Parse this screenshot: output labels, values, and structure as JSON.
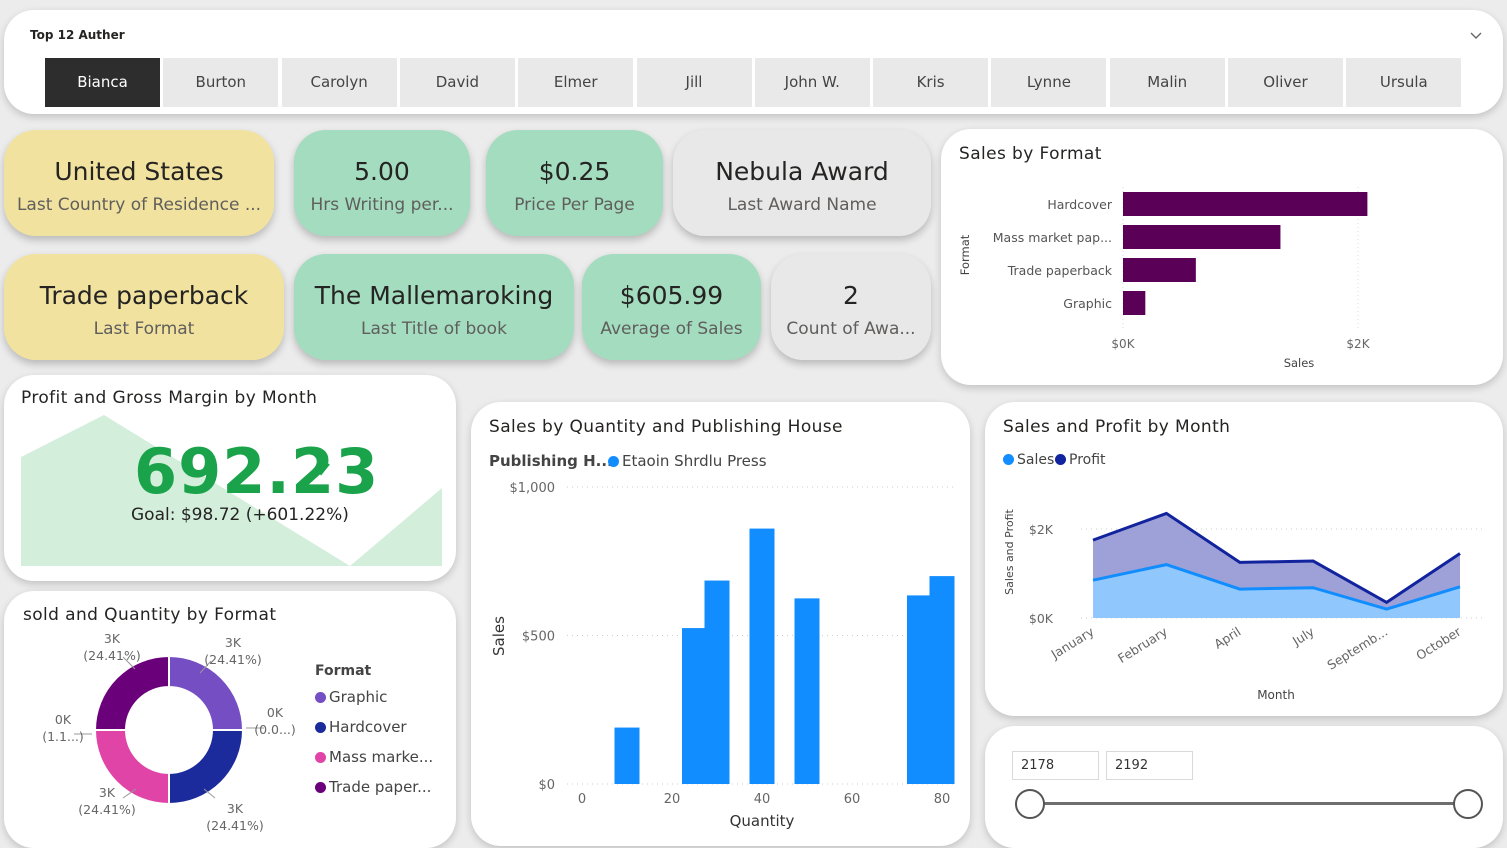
{
  "author_slicer": {
    "title": "Top 12 Auther",
    "chevron_icon": "chevron-down-icon",
    "authors": [
      "Bianca",
      "Burton",
      "Carolyn",
      "David",
      "Elmer",
      "Jill",
      "John W.",
      "Kris",
      "Lynne",
      "Malin",
      "Oliver",
      "Ursula"
    ],
    "selected": "Bianca"
  },
  "cards": [
    {
      "value": "United States",
      "label": "Last Country of Residence ...",
      "color": "#f1e39f"
    },
    {
      "value": "5.00",
      "label": "Hrs Writing per...",
      "color": "#a3dcbf"
    },
    {
      "value": "$0.25",
      "label": "Price Per Page",
      "color": "#a3dcbf"
    },
    {
      "value": "Nebula Award",
      "label": "Last Award Name",
      "color": "#e8e8e8"
    },
    {
      "value": "Trade paperback",
      "label": "Last Format",
      "color": "#f1e39f"
    },
    {
      "value": "The Mallemaroking",
      "label": "Last Title of book",
      "color": "#a3dcbf"
    },
    {
      "value": "$605.99",
      "label": "Average of Sales",
      "color": "#a3dcbf"
    },
    {
      "value": "2",
      "label": "Count of Awa...",
      "color": "#e8e8e8"
    }
  ],
  "kpi": {
    "title": "Profit and Gross Margin by Month",
    "value": "692.23",
    "check_icon": "checkmark-icon",
    "goal": "Goal: $98.72 (+601.22%)",
    "color": "#1aa34a"
  },
  "chart_data": [
    {
      "type": "bar",
      "orientation": "horizontal",
      "title": "Sales by Format",
      "categories": [
        "Hardcover",
        "Mass market pap...",
        "Trade paperback",
        "Graphic"
      ],
      "values": [
        2080,
        1340,
        620,
        190
      ],
      "xlabel": "Sales",
      "ylabel": "Format",
      "xlim": [
        0,
        2000
      ],
      "xticks": [
        "$0K",
        "$2K"
      ],
      "color": "#5b0057"
    },
    {
      "type": "bar",
      "title": "Sales by Quantity and Publishing House",
      "legend_title": "Publishing H...",
      "series": [
        {
          "name": "Etaoin Shrdlu Press",
          "color": "#118dff",
          "x": [
            10,
            25,
            30,
            40,
            50,
            75,
            80
          ],
          "values": [
            190,
            525,
            685,
            860,
            625,
            635,
            700
          ]
        }
      ],
      "xlabel": "Quantity",
      "ylabel": "Sales",
      "xlim": [
        0,
        80
      ],
      "xticks": [
        "0",
        "20",
        "40",
        "60",
        "80"
      ],
      "ylim": [
        0,
        1000
      ],
      "yticks": [
        "$0",
        "$500",
        "$1,000"
      ]
    },
    {
      "type": "area",
      "title": "Sales and Profit by Month",
      "categories": [
        "January",
        "February",
        "April",
        "July",
        "Septemb...",
        "October"
      ],
      "series": [
        {
          "name": "Sales",
          "color": "#118dff",
          "values": [
            850,
            1200,
            650,
            680,
            200,
            700
          ]
        },
        {
          "name": "Profit",
          "color": "#12239e",
          "values": [
            1750,
            2350,
            1250,
            1280,
            350,
            1450
          ]
        }
      ],
      "xlabel": "Month",
      "ylabel": "Sales and Profit",
      "ylim": [
        0,
        2000
      ],
      "yticks": [
        "$0K",
        "$2K"
      ]
    },
    {
      "type": "pie",
      "donut": true,
      "title": "sold and Quantity by Format",
      "legend_title": "Format",
      "categories": [
        "Graphic",
        "Hardcover",
        "Mass marke...",
        "Trade paper..."
      ],
      "values": [
        24.41,
        24.41,
        24.41,
        24.41
      ],
      "colors": [
        "#744ec2",
        "#1c2b9c",
        "#e044a7",
        "#6b007b"
      ],
      "labels": [
        {
          "value": "3K",
          "pct": "(24.41%)"
        },
        {
          "value": "3K",
          "pct": "(24.41%)"
        },
        {
          "value": "3K",
          "pct": "(24.41%)"
        },
        {
          "value": "3K",
          "pct": "(24.41%)"
        },
        {
          "value": "0K",
          "pct": "(0.0...)"
        },
        {
          "value": "0K",
          "pct": "(1.1...)"
        }
      ]
    }
  ],
  "kpi_area_color": "#d3eedb",
  "range_slider": {
    "min": "2178",
    "max": "2192",
    "low_fraction": 0,
    "high_fraction": 1
  }
}
